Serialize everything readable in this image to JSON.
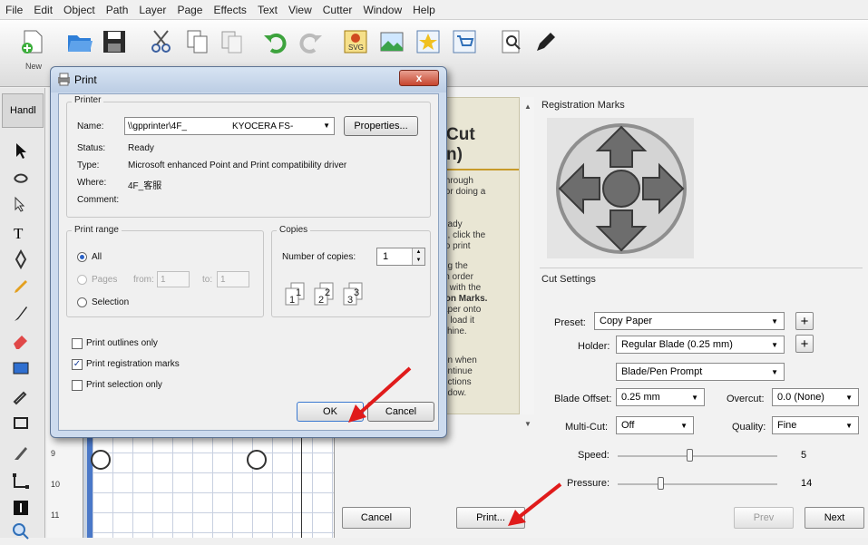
{
  "menu": [
    "File",
    "Edit",
    "Object",
    "Path",
    "Layer",
    "Page",
    "Effects",
    "Text",
    "View",
    "Cutter",
    "Window",
    "Help"
  ],
  "toolbar": {
    "new_label": "New"
  },
  "left_panel": {
    "tab_label": "Handl"
  },
  "ruler": {
    "marks": [
      "9",
      "10",
      "11"
    ]
  },
  "instructions": {
    "heading_1": "Cut",
    "heading_2": "n)",
    "lines": [
      "through",
      "for doing a",
      "eady",
      "n, click the",
      "to print",
      "ng the",
      "in order",
      "k with the",
      "ion Marks.",
      "aper onto",
      "d load it",
      "chine.",
      "on when",
      "ontinue",
      "uctions",
      "ndow."
    ]
  },
  "registration": {
    "title": "Registration Marks"
  },
  "cut_settings": {
    "title": "Cut Settings",
    "preset_label": "Preset:",
    "preset_value": "Copy Paper",
    "holder_label": "Holder:",
    "holder_value": "Regular Blade (0.25 mm)",
    "prompt_value": "Blade/Pen Prompt",
    "blade_offset_label": "Blade Offset:",
    "blade_offset_value": "0.25 mm",
    "overcut_label": "Overcut:",
    "overcut_value": "0.0 (None)",
    "multicut_label": "Multi-Cut:",
    "multicut_value": "Off",
    "quality_label": "Quality:",
    "quality_value": "Fine",
    "speed_label": "Speed:",
    "speed_value": "5",
    "pressure_label": "Pressure:",
    "pressure_value": "14"
  },
  "wizard_buttons": {
    "cancel": "Cancel",
    "print": "Print...",
    "prev": "Prev",
    "next": "Next"
  },
  "print_dialog": {
    "title": "Print",
    "close": "x",
    "printer_group": "Printer",
    "name_label": "Name:",
    "name_value": "\\\\gpprinter\\4F_",
    "name_value_2": "KYOCERA FS-",
    "properties_button": "Properties...",
    "status_label": "Status:",
    "status_value": "Ready",
    "type_label": "Type:",
    "type_value": "Microsoft enhanced Point and Print compatibility driver",
    "where_label": "Where:",
    "where_value": "4F_客服",
    "comment_label": "Comment:",
    "range_group": "Print range",
    "all_label": "All",
    "pages_label": "Pages",
    "from_label": "from:",
    "from_value": "1",
    "to_label": "to:",
    "to_value": "1",
    "selection_label": "Selection",
    "copies_group": "Copies",
    "copies_label": "Number of copies:",
    "copies_value": "1",
    "outlines_label": "Print outlines only",
    "regmarks_label": "Print registration marks",
    "selection_only_label": "Print selection only",
    "ok": "OK",
    "cancel": "Cancel"
  },
  "colors": {
    "dialog_frame": "#cddbee",
    "annotation_arrow": "#e01b1b",
    "mat_edge": "#4a78c8"
  }
}
